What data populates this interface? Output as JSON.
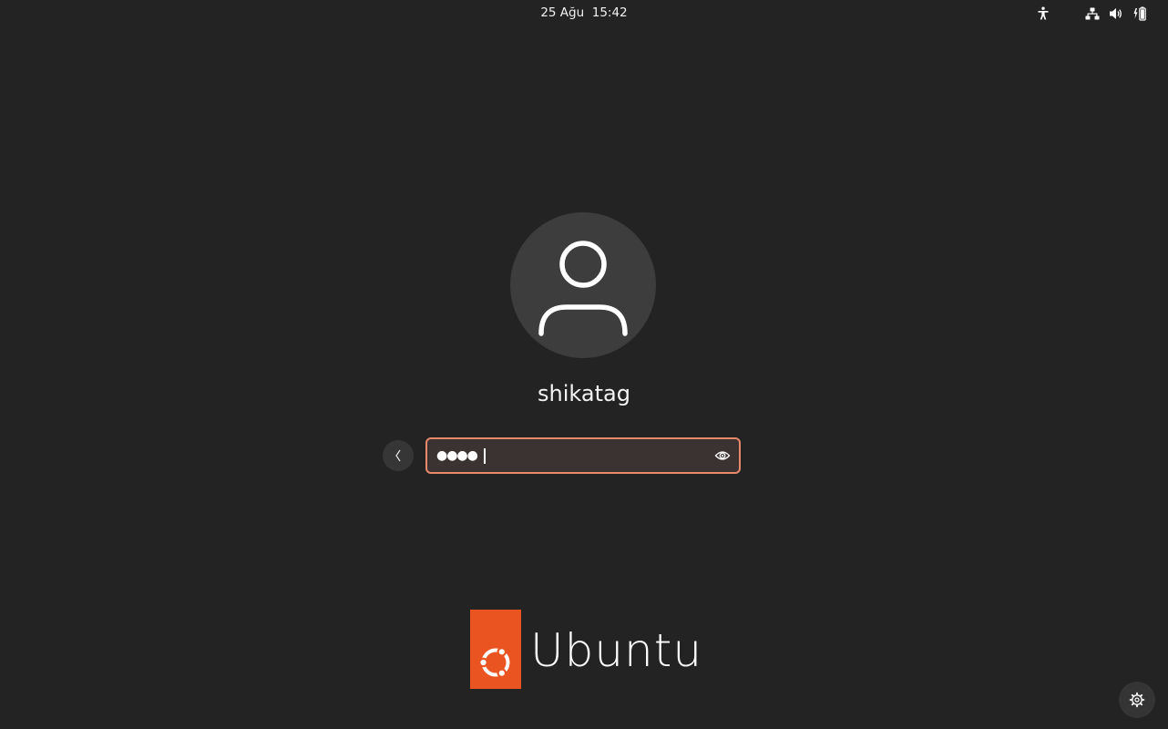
{
  "topbar": {
    "clock": "25 Ağu  15:42",
    "icons": [
      "accessibility-icon",
      "network-icon",
      "volume-icon",
      "battery-icon"
    ]
  },
  "login": {
    "avatar_icon": "user-avatar-icon",
    "username": "shikatag",
    "back_icon": "chevron-left-icon",
    "password_masked": "●●●●",
    "password_length": 4,
    "reveal_icon": "eye-icon",
    "focus_color": "#e9896b"
  },
  "logo": {
    "icon": "ubuntu-circle-of-friends-icon",
    "wordmark": "Ubuntu",
    "brand_color": "#e95420"
  },
  "settings": {
    "icon": "gear-icon"
  }
}
